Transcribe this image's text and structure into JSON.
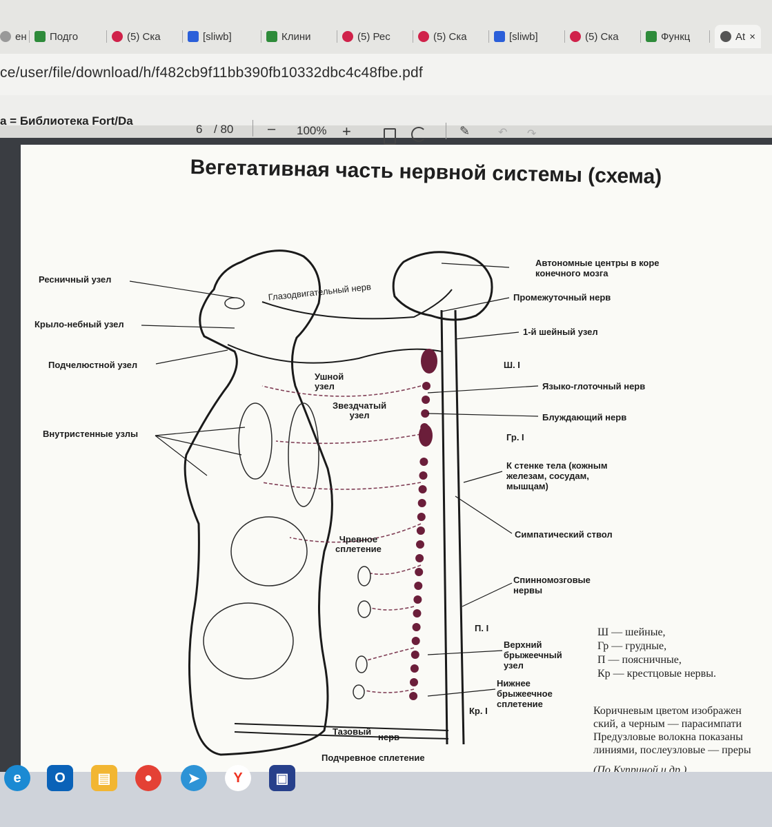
{
  "browser": {
    "tabs": [
      {
        "label": "ен",
        "favicon": "generic"
      },
      {
        "label": "Подго",
        "favicon": "green-doc"
      },
      {
        "label": "(5) Ска",
        "favicon": "red-circle"
      },
      {
        "label": "[sliwb]",
        "favicon": "blue-square"
      },
      {
        "label": "Клини",
        "favicon": "green-doc"
      },
      {
        "label": "(5) Рес",
        "favicon": "red-circle"
      },
      {
        "label": "(5) Ска",
        "favicon": "red-circle"
      },
      {
        "label": "[sliwb]",
        "favicon": "blue-square"
      },
      {
        "label": "(5) Ска",
        "favicon": "red-circle"
      },
      {
        "label": "Функц",
        "favicon": "green-doc"
      },
      {
        "label": "At",
        "favicon": "gray-circle",
        "active": true
      }
    ],
    "tab_close": "×",
    "url": "ce/user/file/download/h/f482cb9f11bb390fb10332dbc4c48fbe.pdf",
    "bookmark": "a = Библиотека Fort/Da"
  },
  "pdf_toolbar": {
    "page_current": "6",
    "page_total": "/ 80",
    "zoom_out": "–",
    "zoom": "100%",
    "zoom_in": "+"
  },
  "document": {
    "title": "Вегетативная часть нервной системы (схема)",
    "labels": {
      "ciliary": "Ресничный узел",
      "pterygo": "Крыло-небный узел",
      "submandibular": "Подчелюстной узел",
      "intramural": "Внутристенные узлы",
      "oculomotor": "Глазодвигательный нерв",
      "otic": "Ушной\nузел",
      "stellate": "Звездчатый\nузел",
      "celiac": "Чревное\nсплетение",
      "autonomic_centers": "Автономные центры в коре\nконечного мозга",
      "intermediate": "Промежуточный нерв",
      "cervical1": "1-й шейный узел",
      "sh1": "Ш. I",
      "glosso": "Языко-глоточный нерв",
      "vagus": "Блуждающий нерв",
      "gr1": "Гр. I",
      "body_wall": "К стенке тела (кожным\nжелезам, сосудам,\nмышцам)",
      "sympathetic_trunk": "Симпатический ствол",
      "spinal": "Спинномозговые\nнервы",
      "p1": "П. I",
      "superior_mesenteric": "Верхний\nбрыжеечный\nузел",
      "inferior_mesenteric": "Нижнее\nбрыжеечное\nсплетение",
      "kr1": "Кр. I",
      "pelvic": "Тазовый",
      "nerve": "нерв",
      "hypogastric": "Подчревное сплетение"
    },
    "legend": [
      "Ш — шейные,",
      "Гр — грудные,",
      "П — поясничные,",
      "Кр — крестцовые нервы."
    ],
    "description": [
      "Коричневым цветом изображен",
      "ский, а черным — парасимпати",
      "Предузловые волокна показаны",
      "линиями, послеузловые — преры"
    ],
    "source": "(По Куприной и др.)"
  },
  "colors": {
    "sympathetic": "#6b1e3a",
    "parasympathetic": "#1a1a1a",
    "page": "#fafaf6"
  },
  "taskbar": {
    "apps": [
      "edge-icon",
      "outlook-icon",
      "file-explorer-icon",
      "chrome-icon",
      "telegram-icon",
      "yandex-icon",
      "save-icon"
    ],
    "yandex_letter": "Y"
  }
}
